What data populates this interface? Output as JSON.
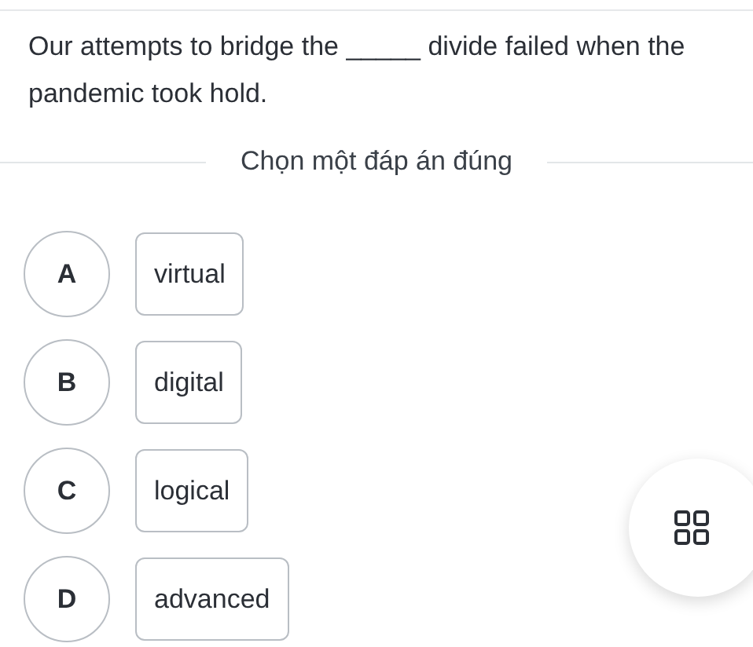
{
  "question": "Our attempts to bridge the _____ divide failed when the pandemic took hold.",
  "instruction": "Chọn một đáp án đúng",
  "options": [
    {
      "letter": "A",
      "text": "virtual",
      "selected": false
    },
    {
      "letter": "B",
      "text": "digital",
      "selected": false
    },
    {
      "letter": "C",
      "text": "logical",
      "selected": false
    },
    {
      "letter": "D",
      "text": "advanced",
      "selected": false
    }
  ]
}
